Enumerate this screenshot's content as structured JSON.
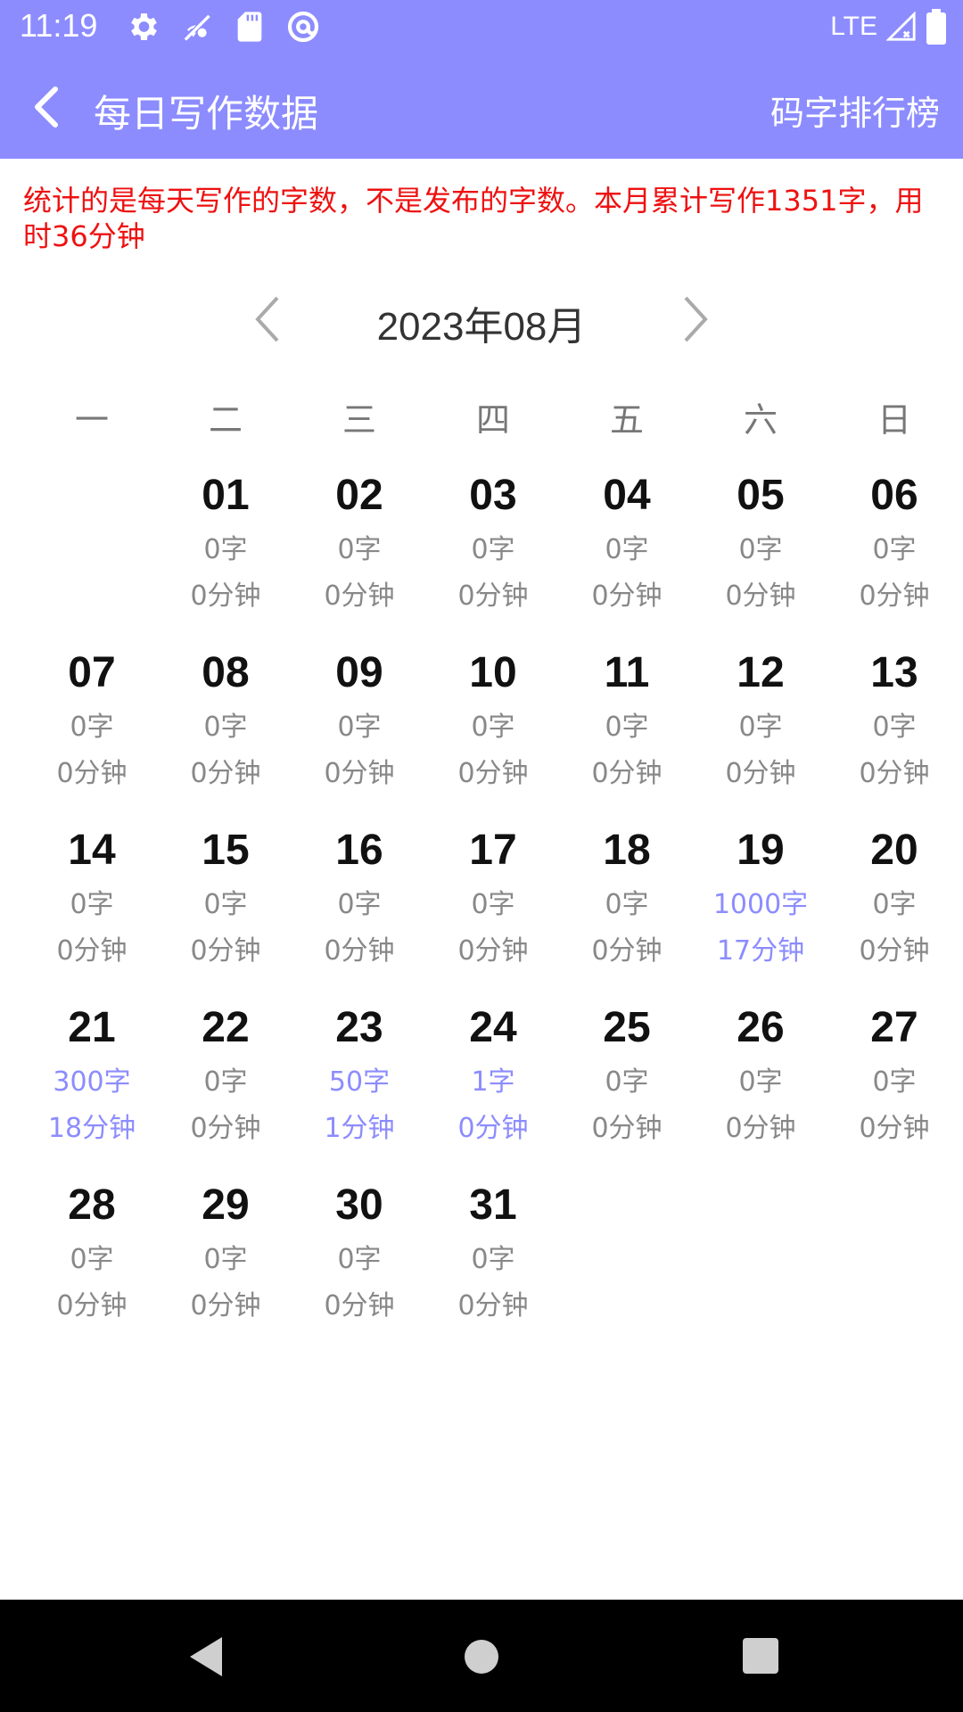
{
  "status_bar": {
    "time": "11:19",
    "network": "LTE",
    "icons": [
      "settings-icon",
      "wifi-off-icon",
      "sd-card-icon",
      "at-sign-icon",
      "signal-icon",
      "battery-icon"
    ]
  },
  "app_bar": {
    "title": "每日写作数据",
    "rank_label": "码字排行榜",
    "back_icon": "chevron-left-icon"
  },
  "notice": "统计的是每天写作的字数，不是发布的字数。本月累计写作1351字，用时36分钟",
  "calendar": {
    "month_label": "2023年08月",
    "weekdays": [
      "一",
      "二",
      "三",
      "四",
      "五",
      "六",
      "日"
    ],
    "days": [
      {
        "day": "01",
        "words": "0字",
        "mins": "0分钟",
        "active": false
      },
      {
        "day": "02",
        "words": "0字",
        "mins": "0分钟",
        "active": false
      },
      {
        "day": "03",
        "words": "0字",
        "mins": "0分钟",
        "active": false
      },
      {
        "day": "04",
        "words": "0字",
        "mins": "0分钟",
        "active": false
      },
      {
        "day": "05",
        "words": "0字",
        "mins": "0分钟",
        "active": false
      },
      {
        "day": "06",
        "words": "0字",
        "mins": "0分钟",
        "active": false
      },
      {
        "day": "07",
        "words": "0字",
        "mins": "0分钟",
        "active": false
      },
      {
        "day": "08",
        "words": "0字",
        "mins": "0分钟",
        "active": false
      },
      {
        "day": "09",
        "words": "0字",
        "mins": "0分钟",
        "active": false
      },
      {
        "day": "10",
        "words": "0字",
        "mins": "0分钟",
        "active": false
      },
      {
        "day": "11",
        "words": "0字",
        "mins": "0分钟",
        "active": false
      },
      {
        "day": "12",
        "words": "0字",
        "mins": "0分钟",
        "active": false
      },
      {
        "day": "13",
        "words": "0字",
        "mins": "0分钟",
        "active": false
      },
      {
        "day": "14",
        "words": "0字",
        "mins": "0分钟",
        "active": false
      },
      {
        "day": "15",
        "words": "0字",
        "mins": "0分钟",
        "active": false
      },
      {
        "day": "16",
        "words": "0字",
        "mins": "0分钟",
        "active": false
      },
      {
        "day": "17",
        "words": "0字",
        "mins": "0分钟",
        "active": false
      },
      {
        "day": "18",
        "words": "0字",
        "mins": "0分钟",
        "active": false
      },
      {
        "day": "19",
        "words": "1000字",
        "mins": "17分钟",
        "active": true
      },
      {
        "day": "20",
        "words": "0字",
        "mins": "0分钟",
        "active": false
      },
      {
        "day": "21",
        "words": "300字",
        "mins": "18分钟",
        "active": true
      },
      {
        "day": "22",
        "words": "0字",
        "mins": "0分钟",
        "active": false
      },
      {
        "day": "23",
        "words": "50字",
        "mins": "1分钟",
        "active": true
      },
      {
        "day": "24",
        "words": "1字",
        "mins": "0分钟",
        "active": true
      },
      {
        "day": "25",
        "words": "0字",
        "mins": "0分钟",
        "active": false
      },
      {
        "day": "26",
        "words": "0字",
        "mins": "0分钟",
        "active": false
      },
      {
        "day": "27",
        "words": "0字",
        "mins": "0分钟",
        "active": false
      },
      {
        "day": "28",
        "words": "0字",
        "mins": "0分钟",
        "active": false
      },
      {
        "day": "29",
        "words": "0字",
        "mins": "0分钟",
        "active": false
      },
      {
        "day": "30",
        "words": "0字",
        "mins": "0分钟",
        "active": false
      },
      {
        "day": "31",
        "words": "0字",
        "mins": "0分钟",
        "active": false
      }
    ]
  },
  "nav_bar": {
    "icons": [
      "back-triangle-icon",
      "home-circle-icon",
      "recents-square-icon"
    ]
  },
  "colors": {
    "accent": "#8c8cff",
    "notice_red": "#ee1111",
    "muted": "#888888"
  }
}
